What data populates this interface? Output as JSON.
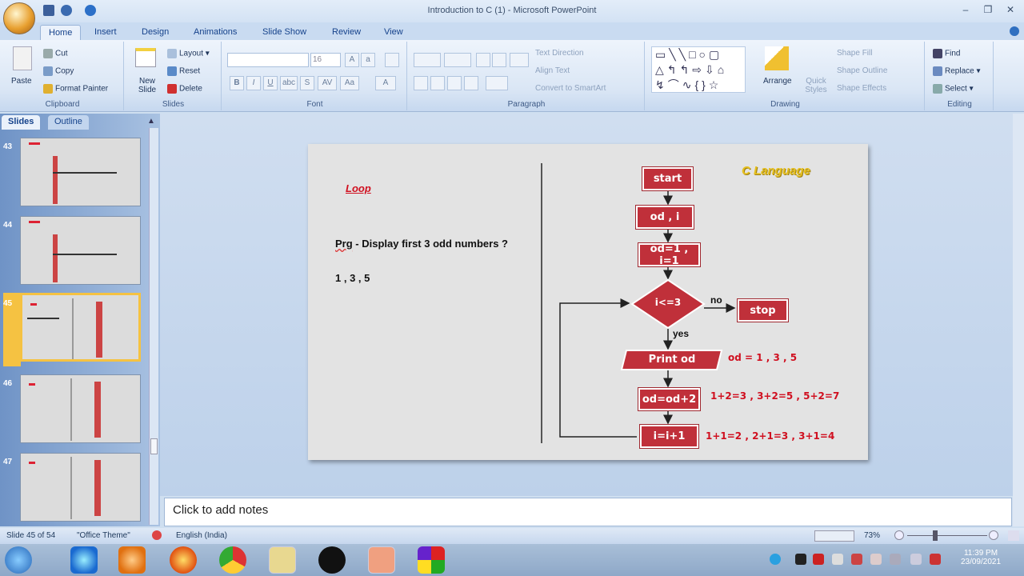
{
  "window": {
    "title": "Introduction to C (1) - Microsoft PowerPoint",
    "minimize": "–",
    "restore": "❐",
    "close": "✕"
  },
  "tabs": [
    "Home",
    "Insert",
    "Design",
    "Animations",
    "Slide Show",
    "Review",
    "View"
  ],
  "ribbon": {
    "clipboard": {
      "label": "Clipboard",
      "paste": "Paste",
      "cut": "Cut",
      "copy": "Copy",
      "format_painter": "Format Painter"
    },
    "slides": {
      "label": "Slides",
      "new_slide": "New Slide",
      "layout": "Layout",
      "reset": "Reset",
      "delete": "Delete"
    },
    "font": {
      "label": "Font",
      "font_name": "",
      "font_size": "16",
      "bold": "B",
      "italic": "I",
      "underline": "U",
      "strike": "abc",
      "shadow": "S",
      "spacing": "AV",
      "case": "Aa",
      "color": "A",
      "grow": "A",
      "shrink": "a"
    },
    "paragraph": {
      "label": "Paragraph",
      "text_direction": "Text Direction",
      "align_text": "Align Text",
      "smartart": "Convert to SmartArt"
    },
    "drawing": {
      "label": "Drawing",
      "arrange": "Arrange",
      "quick_styles": "Quick Styles",
      "shape_fill": "Shape Fill",
      "shape_outline": "Shape Outline",
      "shape_effects": "Shape Effects"
    },
    "editing": {
      "label": "Editing",
      "find": "Find",
      "replace": "Replace",
      "select": "Select"
    }
  },
  "left_pane": {
    "tabs": [
      "Slides",
      "Outline"
    ],
    "thumbnails": [
      {
        "num": "43"
      },
      {
        "num": "44"
      },
      {
        "num": "45",
        "selected": true
      },
      {
        "num": "46"
      },
      {
        "num": "47"
      }
    ]
  },
  "slide": {
    "heading": "Loop",
    "prg": "Prg",
    "question": " - Display first 3 odd numbers ?",
    "answer": "1 , 3 , 5",
    "brand": "C Language",
    "flow": {
      "start": "start",
      "declare": "od , i",
      "init": "od=1 , i=1",
      "cond": "i<=3",
      "no": "no",
      "yes": "yes",
      "stop": "stop",
      "print": "Print od",
      "incr_od": "od=od+2",
      "incr_i": "i=i+1"
    },
    "notes_od": "od = 1  , 3   , 5",
    "notes_incr_od": "1+2=3  , 3+2=5  , 5+2=7",
    "notes_incr_i": "1+1=2  , 2+1=3   , 3+1=4"
  },
  "notes": {
    "placeholder": "Click to add notes"
  },
  "status": {
    "slide": "Slide 45 of 54",
    "theme": "\"Office Theme\"",
    "language": "English (India)",
    "zoom": "73%"
  },
  "taskbar": {
    "time": "11:39 PM",
    "date": "23/09/2021"
  }
}
